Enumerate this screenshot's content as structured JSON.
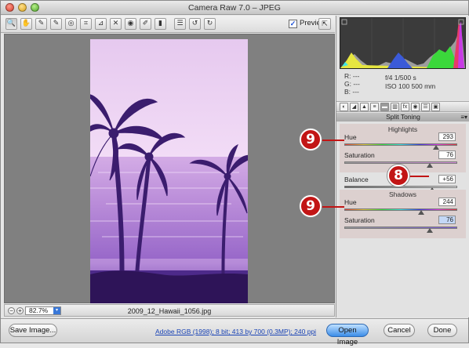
{
  "window": {
    "title": "Camera Raw 7.0  –  JPEG"
  },
  "toolbar": {
    "tools": [
      {
        "icon": "zoom-icon",
        "glyph": "🔍"
      },
      {
        "icon": "hand-icon",
        "glyph": "✋"
      },
      {
        "icon": "white-balance-icon",
        "glyph": "✎"
      },
      {
        "icon": "color-sampler-icon",
        "glyph": "✎"
      },
      {
        "icon": "targeted-adjustment-icon",
        "glyph": "◎"
      },
      {
        "icon": "crop-icon",
        "glyph": "⌗"
      },
      {
        "icon": "straighten-icon",
        "glyph": "⊿"
      },
      {
        "icon": "spot-removal-icon",
        "glyph": "✕"
      },
      {
        "icon": "red-eye-icon",
        "glyph": "◉"
      },
      {
        "icon": "adjustment-brush-icon",
        "glyph": "✐"
      },
      {
        "icon": "graduated-filter-icon",
        "glyph": "▮"
      },
      {
        "icon": "preferences-icon",
        "glyph": "☰"
      },
      {
        "icon": "rotate-left-icon",
        "glyph": "↺"
      },
      {
        "icon": "rotate-right-icon",
        "glyph": "↻"
      }
    ],
    "preview_label": "Preview",
    "preview_checked": true
  },
  "canvas": {
    "zoom_value": "82.7%",
    "filename": "2009_12_Hawaii_1056.jpg"
  },
  "readout": {
    "r": "R:   ---",
    "g": "G:   ---",
    "b": "B:   ---",
    "aperture_shutter": "f/4     1/500 s",
    "iso_focal": "ISO 100    500 mm"
  },
  "panel": {
    "title": "Split Toning",
    "highlights": {
      "heading": "Highlights",
      "hue_label": "Hue",
      "hue_value": "293",
      "hue_level": 0.81,
      "saturation_label": "Saturation",
      "saturation_value": "76",
      "saturation_level": 0.76
    },
    "balance": {
      "label": "Balance",
      "value": "+56",
      "level": 0.78
    },
    "shadows": {
      "heading": "Shadows",
      "hue_label": "Hue",
      "hue_value": "244",
      "hue_level": 0.68,
      "saturation_label": "Saturation",
      "saturation_value": "76",
      "saturation_level": 0.76
    }
  },
  "callouts": [
    {
      "label": "9"
    },
    {
      "label": "8"
    },
    {
      "label": "9"
    }
  ],
  "bottom": {
    "save_image": "Save Image...",
    "workflow": "Adobe RGB (1998); 8 bit; 413 by 700 (0.3MP); 240 ppi",
    "open_image": "Open Image",
    "cancel": "Cancel",
    "done": "Done"
  },
  "colors": {
    "callout": "#c21515",
    "photo_tint": "#b58ad8",
    "primary_button": "#3b8de8"
  }
}
